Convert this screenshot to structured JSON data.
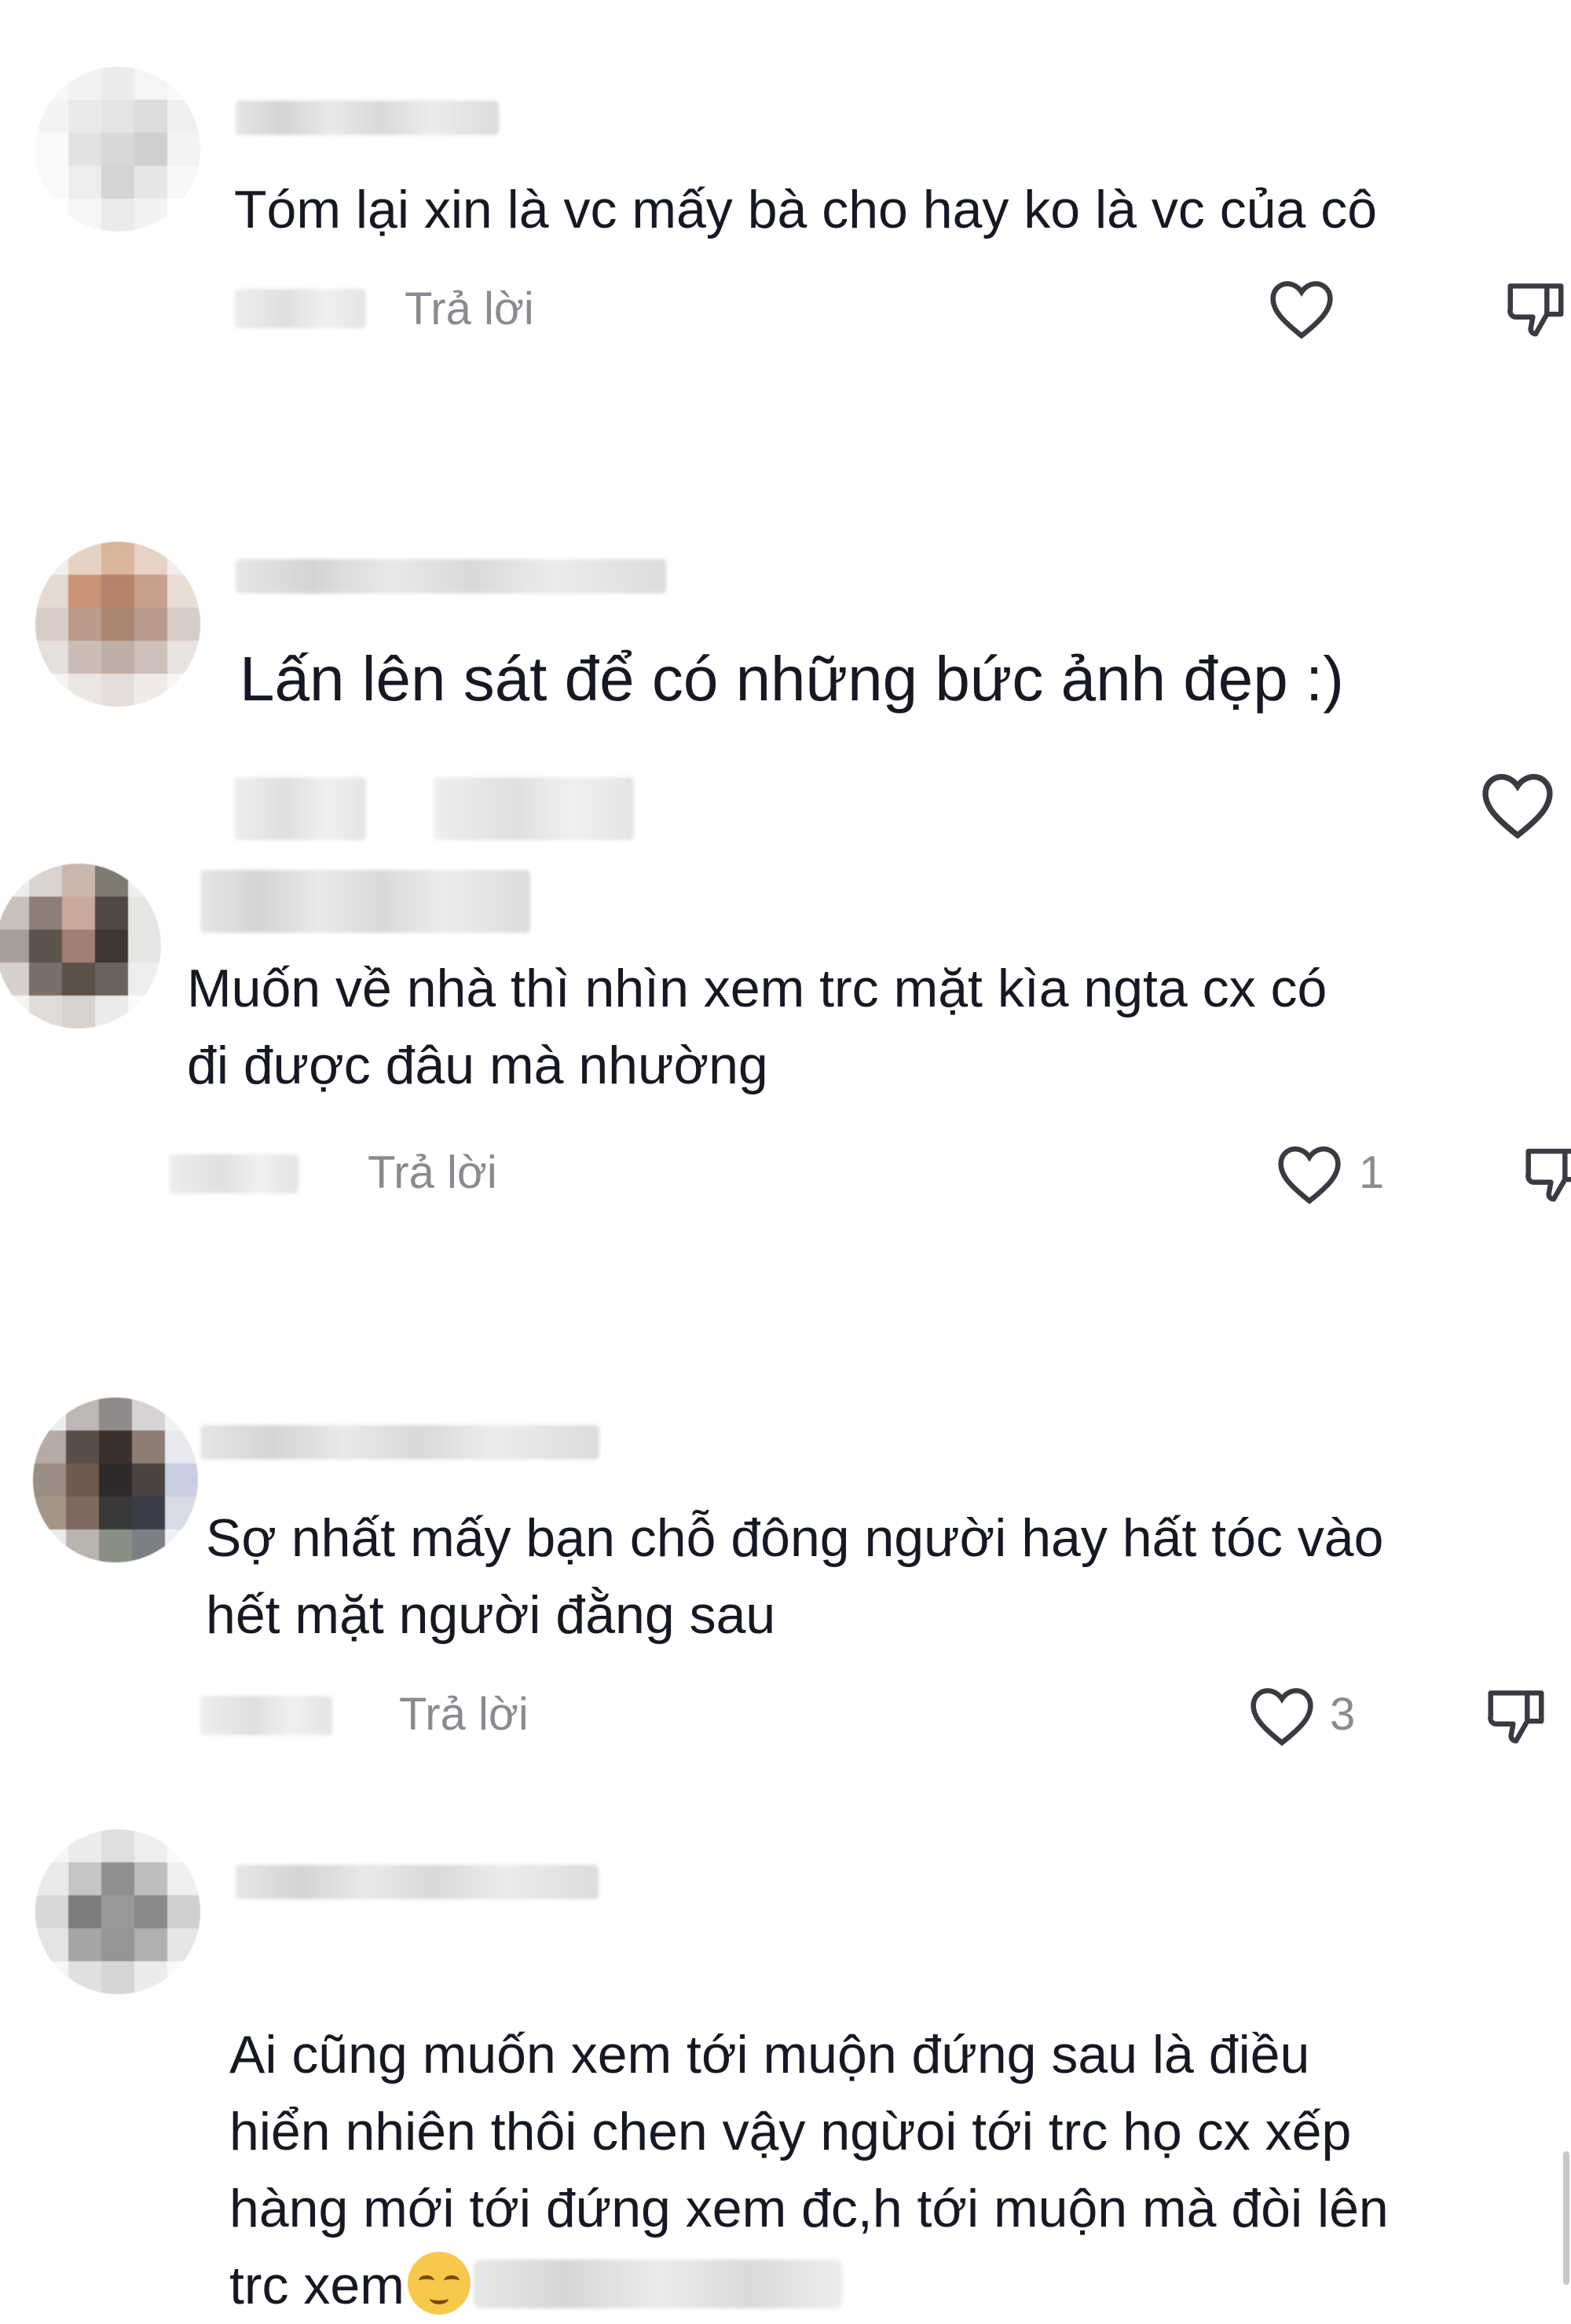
{
  "comments": [
    {
      "text": "Tóm lại xin là vc mấy bà cho hay ko là vc của cô",
      "reply_label": "Trả lời",
      "like_count": "",
      "avatar_colors": [
        "#f7f7f7",
        "#f2f2f2",
        "#ececec",
        "#f5f5f5",
        "#fafafa",
        "#f4f4f4",
        "#e9e9e9",
        "#e4e4e4",
        "#dcdcdc",
        "#f0f0f0",
        "#fafafa",
        "#e2e2e2",
        "#d8d8d8",
        "#cfcfcf",
        "#f3f3f3",
        "#fafafa",
        "#ededed",
        "#d4d4d4",
        "#e6e6e6",
        "#f8f8f8",
        "#ffffff",
        "#f6f6f6",
        "#ebebeb",
        "#f2f2f2",
        "#ffffff"
      ]
    },
    {
      "text": "Lấn lên sát để có những bức ảnh đẹp :)",
      "reply_label": "",
      "like_count": "",
      "avatar_colors": [
        "#f3efe9",
        "#e6d2c2",
        "#d8b59b",
        "#e7d3c6",
        "#f4eeea",
        "#e5d9d0",
        "#c99476",
        "#b5836a",
        "#c89f8a",
        "#e8dcd4",
        "#d9cdc8",
        "#b99a8c",
        "#a98572",
        "#b89b8d",
        "#d8ccc6",
        "#e6e0dd",
        "#cbbcb6",
        "#bfaea5",
        "#cdbfb9",
        "#e8e3e0",
        "#f6f4f3",
        "#ebe6e4",
        "#e4ddd9",
        "#efebe9",
        "#f8f6f5"
      ]
    },
    {
      "text": "Muốn về nhà thì nhìn xem trc mặt kìa ngta cx có\nđi được đâu mà nhường",
      "reply_label": "Trả lời",
      "like_count": "1",
      "avatar_colors": [
        "#efeeee",
        "#d9d4d0",
        "#c9b7ad",
        "#7f7a70",
        "#f0efef",
        "#c8c0bb",
        "#8d7f78",
        "#c9a99c",
        "#4f4942",
        "#e8e6e5",
        "#a89e98",
        "#5e524c",
        "#9f7f73",
        "#3d3631",
        "#e7e5e4",
        "#d6d1ce",
        "#7a6e68",
        "#5c5049",
        "#6b625c",
        "#efeeed",
        "#f7f6f6",
        "#e1dcd9",
        "#d8d2cf",
        "#ecebea",
        "#fafafa"
      ]
    },
    {
      "text": "Sợ nhất mấy bạn chỗ đông người hay hất tóc vào\nhết mặt người đằng sau",
      "reply_label": "Trả lời",
      "like_count": "3",
      "avatar_colors": [
        "#eeeeee",
        "#bdb8b5",
        "#8e8b8a",
        "#d6d3d2",
        "#f2f2f2",
        "#b5aaa4",
        "#5b4e49",
        "#3a312e",
        "#8c7c73",
        "#e8e9ee",
        "#9c8d84",
        "#6e5a50",
        "#2f2a2a",
        "#4b4342",
        "#c9cfe0",
        "#a49687",
        "#7d6a5f",
        "#3a3737",
        "#3b3d48",
        "#d8dbe6",
        "#ebebea",
        "#b9b4ad",
        "#8a8f86",
        "#7c7f84",
        "#f1f1f3"
      ]
    },
    {
      "text": "Ai cũng muốn xem tới muộn đứng sau là điều\nhiển nhiên thôi chen vậy ngừoi tới trc họ cx xếp\nhàng mới tới đứng xem đc,h tới muộn mà đòi lên\ntrc xem",
      "reply_label": "",
      "like_count": "",
      "avatar_colors": [
        "#f7f7f7",
        "#ececec",
        "#dfdfdf",
        "#eeeeee",
        "#fafafa",
        "#eaeaea",
        "#c5c5c5",
        "#8f8f8f",
        "#bdbdbd",
        "#efefef",
        "#d8d8d8",
        "#7d7d7d",
        "#9a9a9a",
        "#8a8a8a",
        "#d0d0d0",
        "#e4e4e4",
        "#a6a6a6",
        "#959595",
        "#b0b0b0",
        "#e6e6e6",
        "#f6f6f6",
        "#e0e0e0",
        "#d6d6d6",
        "#ececec",
        "#fafafa"
      ]
    }
  ],
  "colors": {
    "text": "#161823",
    "secondary": "#8a8b91",
    "icon": "#3a3b42"
  },
  "icons": {
    "like": "heart-icon",
    "dislike": "thumbs-down-icon"
  }
}
